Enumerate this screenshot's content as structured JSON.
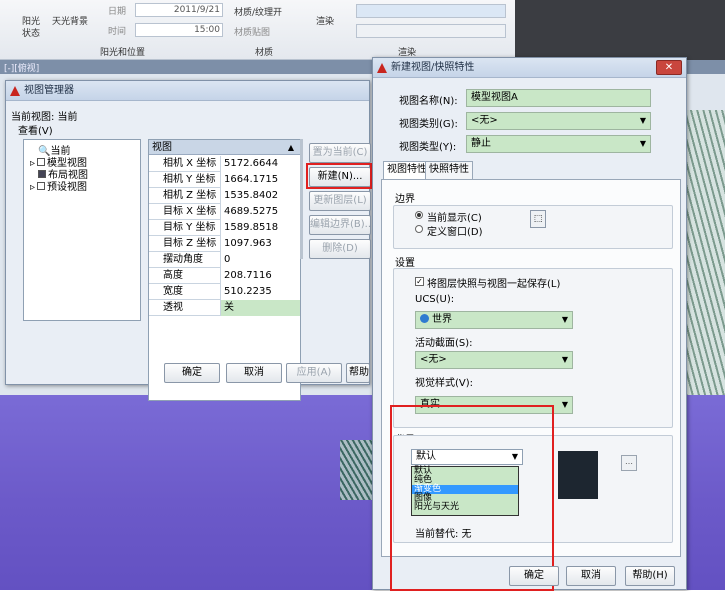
{
  "ribbon": {
    "sun_label": "阳光",
    "sun_state_label": "状态",
    "sky_bg_label": "天光背景",
    "date_value": "2011/9/21",
    "date_label": "日期",
    "time_label": "时间",
    "time_value": "15:00",
    "material_map_label": "材质/纹理开",
    "material_texture_label": "材质贴图",
    "render_label": "渲染",
    "panel_sun_location": "阳光和位置",
    "panel_materials": "材质",
    "panel_render": "渲染"
  },
  "viewport": {
    "tab_label": "[-][俯视]"
  },
  "view_manager": {
    "title": "视图管理器",
    "current_view": "当前视图: 当前",
    "search_label": "查看(V)",
    "tree": [
      "当前",
      "模型视图",
      "布局视图",
      "预设视图"
    ],
    "grid_header": "视图",
    "rows": [
      {
        "key": "相机 X 坐标",
        "value": "5172.6644"
      },
      {
        "key": "相机 Y 坐标",
        "value": "1664.1715"
      },
      {
        "key": "相机 Z 坐标",
        "value": "1535.8402"
      },
      {
        "key": "目标 X 坐标",
        "value": "4689.5275"
      },
      {
        "key": "目标 Y 坐标",
        "value": "1589.8518"
      },
      {
        "key": "目标 Z 坐标",
        "value": "1097.963"
      },
      {
        "key": "摆动角度",
        "value": "0"
      },
      {
        "key": "高度",
        "value": "208.7116"
      },
      {
        "key": "宽度",
        "value": "510.2235"
      },
      {
        "key": "透视",
        "value": "关"
      }
    ],
    "buttons": {
      "set_current": "置为当前(C)",
      "new": "新建(N)...",
      "update_layers": "更新图层(L)",
      "edit_boundaries": "编辑边界(B)...",
      "delete": "删除(D)",
      "ok": "确定",
      "cancel": "取消",
      "apply": "应用(A)",
      "help": "帮助(H)"
    }
  },
  "new_view": {
    "title": "新建视图/快照特性",
    "view_name_label": "视图名称(N):",
    "view_name_value": "模型视图A",
    "view_category_label": "视图类别(G):",
    "view_category_value": "<无>",
    "view_type_label": "视图类型(Y):",
    "view_type_value": "静止",
    "tabs": [
      "视图特性",
      "快照特性"
    ],
    "boundary_group": "边界",
    "boundary_current": "当前显示(C)",
    "boundary_define": "定义窗口(D)",
    "settings_group": "设置",
    "save_layers": "将图层快照与视图一起保存(L)",
    "ucs_label": "UCS(U):",
    "ucs_value": "世界",
    "section_label": "活动截面(S):",
    "section_value": "<无>",
    "visual_style_label": "视觉样式(V):",
    "visual_style_value": "真实",
    "background_group": "背景",
    "background_value": "默认",
    "background_options": [
      "默认",
      "纯色",
      "渐变色",
      "图像",
      "阳光与天光"
    ],
    "background_selected": "渐变色",
    "current_override": "当前替代: 无",
    "buttons": {
      "ok": "确定",
      "cancel": "取消",
      "help": "帮助(H)"
    },
    "swatch_color": "#1d2630"
  },
  "colors": {
    "highlight_red": "#e02020",
    "field_green": "#c9e7c7",
    "select_blue": "#3399ff"
  }
}
